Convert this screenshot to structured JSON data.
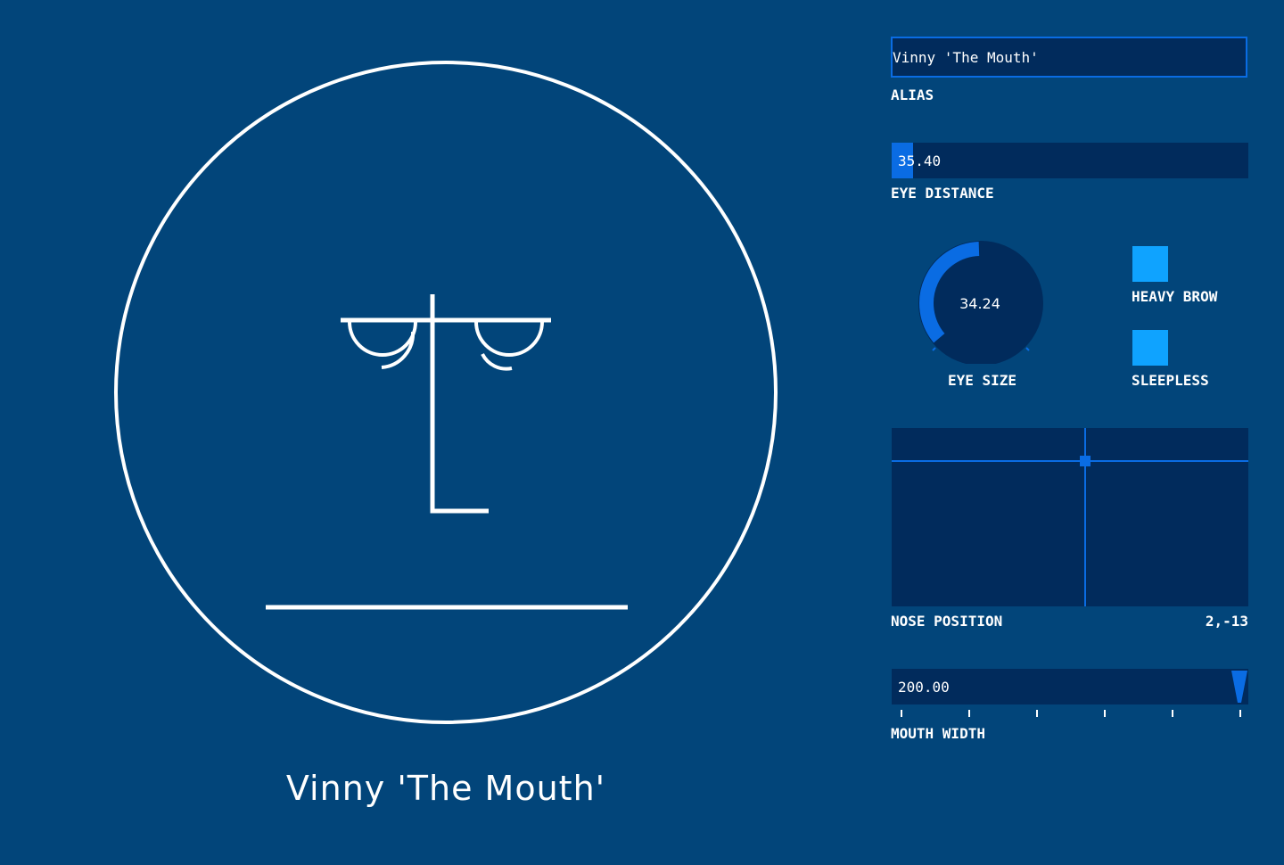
{
  "face": {
    "name": "Vinny 'The Mouth'"
  },
  "controls": {
    "alias": {
      "label": "ALIAS",
      "value": "Vinny 'The Mouth'"
    },
    "eye_distance": {
      "label": "EYE DISTANCE",
      "value": "35.40"
    },
    "eye_size": {
      "label": "EYE SIZE",
      "value": "34.24"
    },
    "heavy_brow": {
      "label": "HEAVY BROW"
    },
    "sleepless": {
      "label": "SLEEPLESS"
    },
    "nose_position": {
      "label": "NOSE POSITION",
      "value": "2,-13"
    },
    "mouth_width": {
      "label": "MOUTH WIDTH",
      "value": "200.00"
    }
  },
  "colors": {
    "background": "#02457a",
    "panel": "#012b5c",
    "accent": "#0a6ce3",
    "toggle": "#0fa3ff",
    "stroke": "#ffffff"
  },
  "icons": {
    "knob": "rotary-knob-icon",
    "slider_thumb": "triangle-down-icon"
  }
}
